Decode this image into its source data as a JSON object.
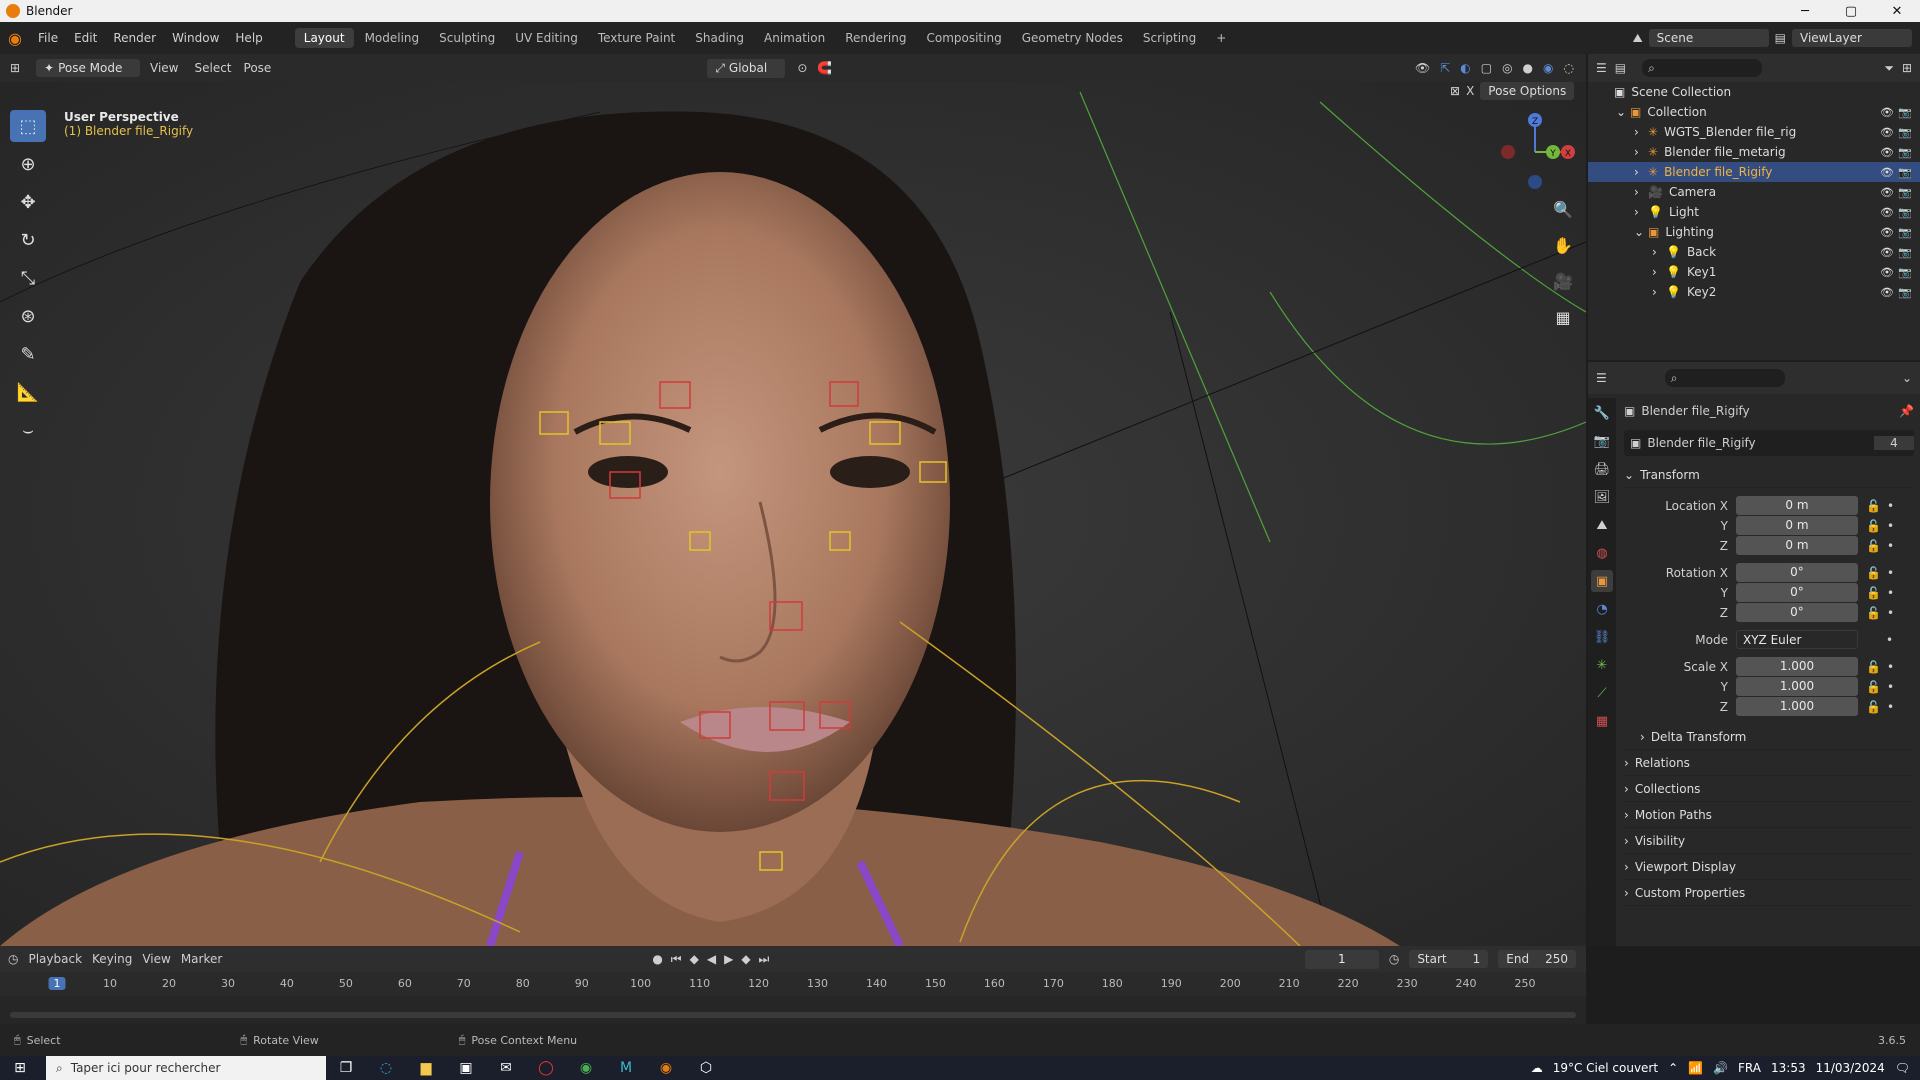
{
  "window": {
    "title": "Blender",
    "min": "─",
    "max": "▢",
    "close": "✕"
  },
  "menus": [
    "File",
    "Edit",
    "Render",
    "Window",
    "Help"
  ],
  "workspaces": [
    "Layout",
    "Modeling",
    "Sculpting",
    "UV Editing",
    "Texture Paint",
    "Shading",
    "Animation",
    "Rendering",
    "Compositing",
    "Geometry Nodes",
    "Scripting"
  ],
  "active_workspace": "Layout",
  "scene": {
    "name": "Scene",
    "view_layer": "ViewLayer"
  },
  "viewport_header": {
    "mode": "Pose Mode",
    "view": "View",
    "select": "Select",
    "pose": "Pose",
    "orientation": "Global"
  },
  "viewport": {
    "perspective": "User Perspective",
    "object_label": "(1) Blender file_Rigify",
    "pose_options": "Pose Options"
  },
  "gizmo": {
    "x": "X",
    "y": "Y",
    "z": "Z"
  },
  "outliner": {
    "root": "Scene Collection",
    "items": [
      {
        "label": "Collection",
        "indent": 1,
        "expanded": true
      },
      {
        "label": "WGTS_Blender file_rig",
        "indent": 2
      },
      {
        "label": "Blender file_metarig",
        "indent": 2
      },
      {
        "label": "Blender file_Rigify",
        "indent": 2,
        "selected": true
      },
      {
        "label": "Camera",
        "indent": 2
      },
      {
        "label": "Light",
        "indent": 2
      },
      {
        "label": "Lighting",
        "indent": 2,
        "expanded": true
      },
      {
        "label": "Back",
        "indent": 3
      },
      {
        "label": "Key1",
        "indent": 3
      },
      {
        "label": "Key2",
        "indent": 3
      }
    ]
  },
  "properties": {
    "object_name": "Blender file_Rigify",
    "datablock": "Blender file_Rigify",
    "datablock_users": "4",
    "transform_header": "Transform",
    "location": {
      "label_x": "Location X",
      "label_y": "Y",
      "label_z": "Z",
      "x": "0 m",
      "y": "0 m",
      "z": "0 m"
    },
    "rotation": {
      "label_x": "Rotation X",
      "label_y": "Y",
      "label_z": "Z",
      "x": "0°",
      "y": "0°",
      "z": "0°"
    },
    "mode_label": "Mode",
    "mode_value": "XYZ Euler",
    "scale": {
      "label_x": "Scale X",
      "label_y": "Y",
      "label_z": "Z",
      "x": "1.000",
      "y": "1.000",
      "z": "1.000"
    },
    "delta_transform": "Delta Transform",
    "sections": [
      "Relations",
      "Collections",
      "Motion Paths",
      "Visibility",
      "Viewport Display",
      "Custom Properties"
    ]
  },
  "timeline": {
    "playback": "Playback",
    "keying": "Keying",
    "view": "View",
    "marker": "Marker",
    "current_frame": "1",
    "start_label": "Start",
    "start": "1",
    "end_label": "End",
    "end": "250",
    "ticks": [
      "1",
      "10",
      "20",
      "30",
      "40",
      "50",
      "60",
      "70",
      "80",
      "90",
      "100",
      "110",
      "120",
      "130",
      "140",
      "150",
      "160",
      "170",
      "180",
      "190",
      "200",
      "210",
      "220",
      "230",
      "240",
      "250"
    ]
  },
  "statusbar": {
    "select": "Select",
    "rotate": "Rotate View",
    "context": "Pose Context Menu",
    "version": "3.6.5"
  },
  "taskbar": {
    "search_placeholder": "Taper ici pour rechercher",
    "weather": "19°C Ciel couvert",
    "lang": "FRA",
    "time": "13:53",
    "date": "11/03/2024"
  }
}
